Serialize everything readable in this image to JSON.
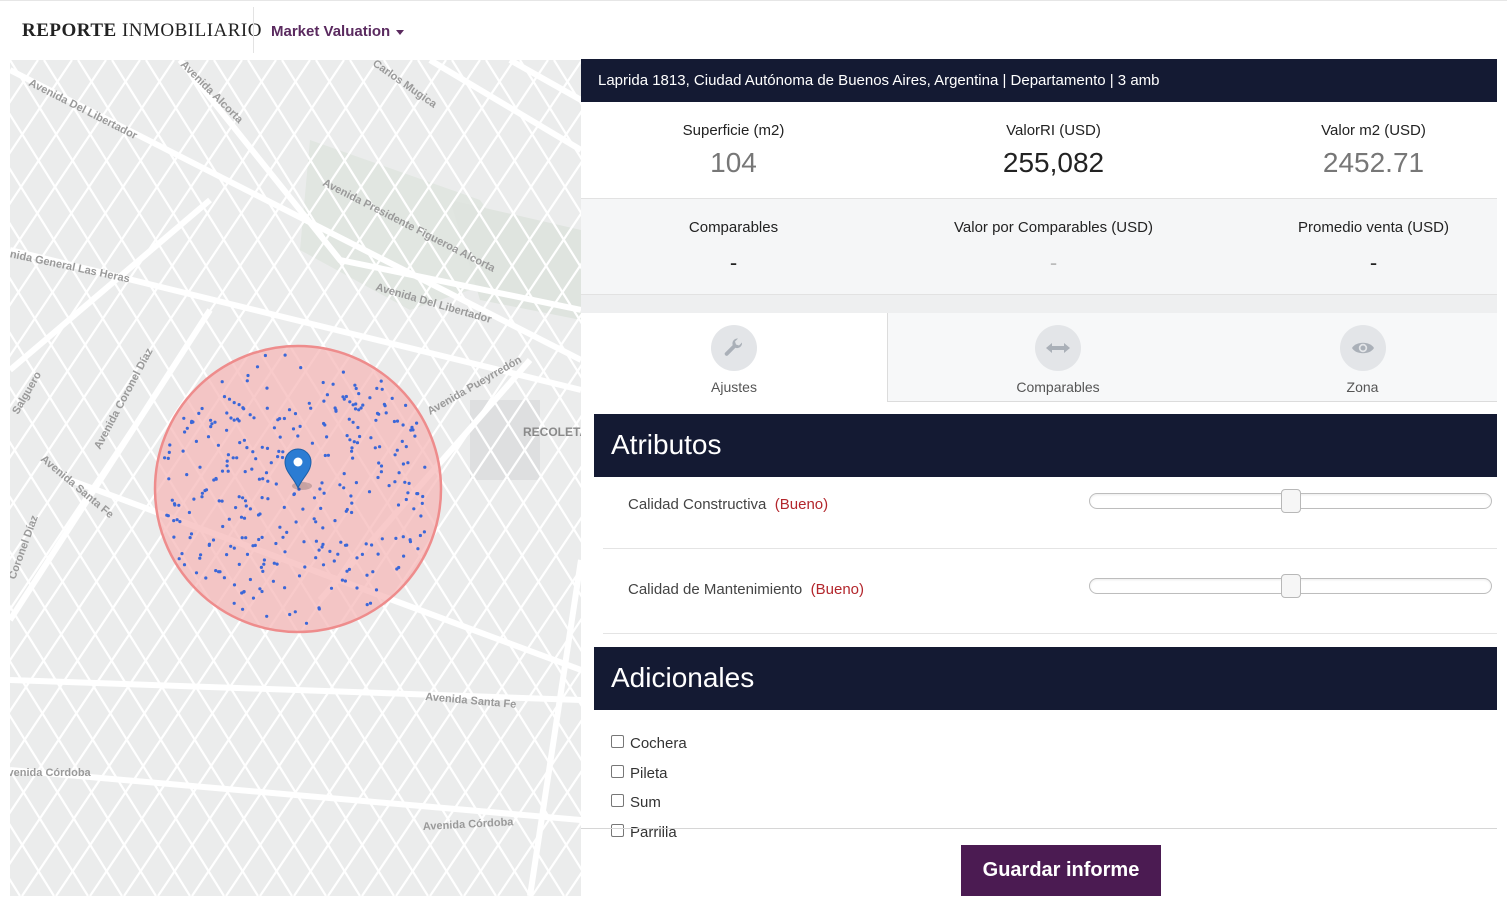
{
  "header": {
    "brand_bold": "REPORTE",
    "brand_rest": "INMOBILIARIO",
    "menu_label": "Market Valuation"
  },
  "map": {
    "street_labels": [
      "Avenida Del Libertador",
      "Avenida Presidente Figueroa Alcorta",
      "Avenida General Las Heras",
      "Avenida Del Libertador",
      "Avenida Coronel Díaz",
      "Avenida Pueyrredón",
      "RECOLETA",
      "Avenida Santa Fe",
      "Avenida Santa Fe",
      "Avenida Córdoba",
      "Avenida Córdoba",
      "Salguero",
      "Coronel Díaz",
      "Avenida Alcorta",
      "Carlos Mugica"
    ],
    "circle_fill": "#f7b9b9",
    "circle_stroke": "#ef8f8f",
    "dot_color": "#3b67d8",
    "pin_color": "#2b7cd3"
  },
  "address_bar": "Laprida 1813, Ciudad Autónoma de Buenos Aires, Argentina | Departamento | 3 amb",
  "stats": [
    {
      "label": "Superficie (m2)",
      "value": "104"
    },
    {
      "label": "ValorRI (USD)",
      "value": "255,082"
    },
    {
      "label": "Valor m2 (USD)",
      "value": "2452.71"
    }
  ],
  "stats2": [
    {
      "label": "Comparables",
      "value": "-"
    },
    {
      "label": "Valor por Comparables (USD)",
      "value": "-"
    },
    {
      "label": "Promedio venta (USD)",
      "value": "-"
    }
  ],
  "tabs": [
    {
      "label": "Ajustes",
      "icon": "wrench-icon"
    },
    {
      "label": "Comparables",
      "icon": "arrows-horizontal-icon"
    },
    {
      "label": "Zona",
      "icon": "eye-icon"
    }
  ],
  "atributos": {
    "title": "Atributos",
    "rows": [
      {
        "label": "Calidad Constructiva",
        "quality": "Bueno",
        "level": 0.5
      },
      {
        "label": "Calidad de Mantenimiento",
        "quality": "Bueno",
        "level": 0.5
      }
    ]
  },
  "adicionales": {
    "title": "Adicionales",
    "options": [
      "Cochera",
      "Pileta",
      "Sum",
      "Parrilla"
    ]
  },
  "save_button": "Guardar informe"
}
